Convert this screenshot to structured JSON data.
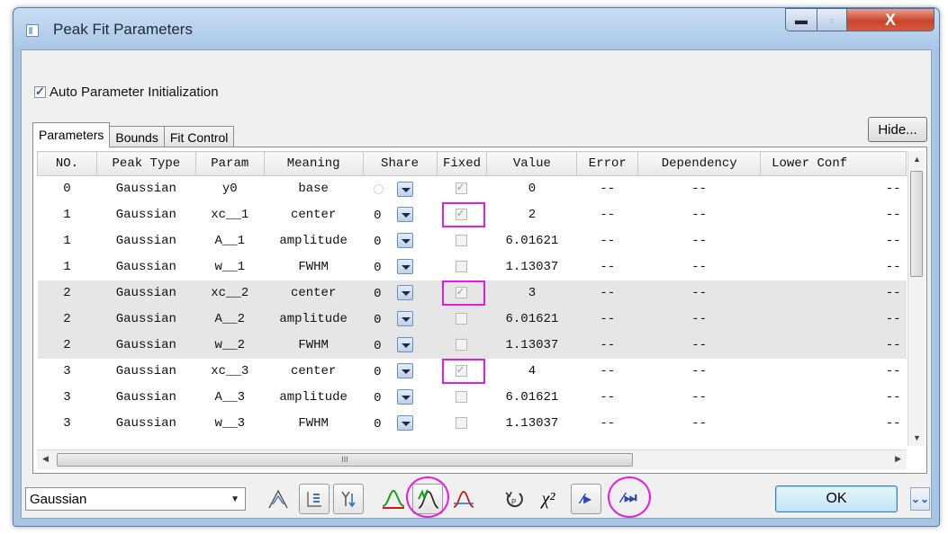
{
  "window": {
    "title": "Peak Fit Parameters",
    "controls": {
      "minimize": "▬",
      "maximize": "▫",
      "close": "X"
    }
  },
  "auto_init": {
    "label": "Auto Parameter Initialization",
    "checked": true
  },
  "tabs": [
    {
      "label": "Parameters",
      "active": true
    },
    {
      "label": "Bounds",
      "active": false
    },
    {
      "label": "Fit Control",
      "active": false
    }
  ],
  "hide_button": "Hide...",
  "table": {
    "columns": [
      "NO.",
      "Peak Type",
      "Param",
      "Meaning",
      "Share",
      "Fixed",
      "Value",
      "Error",
      "Dependency",
      "Lower Conf"
    ],
    "rows": [
      {
        "no": "0",
        "type": "Gaussian",
        "param": "y0",
        "meaning": "base",
        "share": "",
        "fixed": true,
        "value": "0",
        "error": "--",
        "dep": "--",
        "lower": "--"
      },
      {
        "no": "1",
        "type": "Gaussian",
        "param": "xc__1",
        "meaning": "center",
        "share": "0",
        "fixed": true,
        "value": "2",
        "error": "--",
        "dep": "--",
        "lower": "--"
      },
      {
        "no": "1",
        "type": "Gaussian",
        "param": "A__1",
        "meaning": "amplitude",
        "share": "0",
        "fixed": false,
        "value": "6.01621",
        "error": "--",
        "dep": "--",
        "lower": "--"
      },
      {
        "no": "1",
        "type": "Gaussian",
        "param": "w__1",
        "meaning": "FWHM",
        "share": "0",
        "fixed": false,
        "value": "1.13037",
        "error": "--",
        "dep": "--",
        "lower": "--"
      },
      {
        "no": "2",
        "type": "Gaussian",
        "param": "xc__2",
        "meaning": "center",
        "share": "0",
        "fixed": true,
        "value": "3",
        "error": "--",
        "dep": "--",
        "lower": "--"
      },
      {
        "no": "2",
        "type": "Gaussian",
        "param": "A__2",
        "meaning": "amplitude",
        "share": "0",
        "fixed": false,
        "value": "6.01621",
        "error": "--",
        "dep": "--",
        "lower": "--"
      },
      {
        "no": "2",
        "type": "Gaussian",
        "param": "w__2",
        "meaning": "FWHM",
        "share": "0",
        "fixed": false,
        "value": "1.13037",
        "error": "--",
        "dep": "--",
        "lower": "--"
      },
      {
        "no": "3",
        "type": "Gaussian",
        "param": "xc__3",
        "meaning": "center",
        "share": "0",
        "fixed": true,
        "value": "4",
        "error": "--",
        "dep": "--",
        "lower": "--"
      },
      {
        "no": "3",
        "type": "Gaussian",
        "param": "A__3",
        "meaning": "amplitude",
        "share": "0",
        "fixed": false,
        "value": "6.01621",
        "error": "--",
        "dep": "--",
        "lower": "--"
      },
      {
        "no": "3",
        "type": "Gaussian",
        "param": "w__3",
        "meaning": "FWHM",
        "share": "0",
        "fixed": false,
        "value": "1.13037",
        "error": "--",
        "dep": "--",
        "lower": "--"
      }
    ]
  },
  "hscroll_grip": "III",
  "function_select": "Gaussian",
  "toolbar_icons": [
    "peak-shape-icon",
    "sort-icon",
    "arrange-icon",
    "show-curve-icon",
    "fit-one-iteration-icon",
    "show-residual-icon",
    "reset-icon",
    "chi-square-icon",
    "fit-step-icon",
    "fit-until-converged-icon"
  ],
  "toolbar_glyphs": {
    "chi": "χ²",
    "fit_step": "⁄▸",
    "fit_converge": "⁄⏭"
  },
  "ok_button": "OK",
  "more_button": "⌄⌄",
  "colors": {
    "highlight": "#e11ee0",
    "curve_green": "#1f9e1f",
    "curve_red": "#d01818"
  }
}
